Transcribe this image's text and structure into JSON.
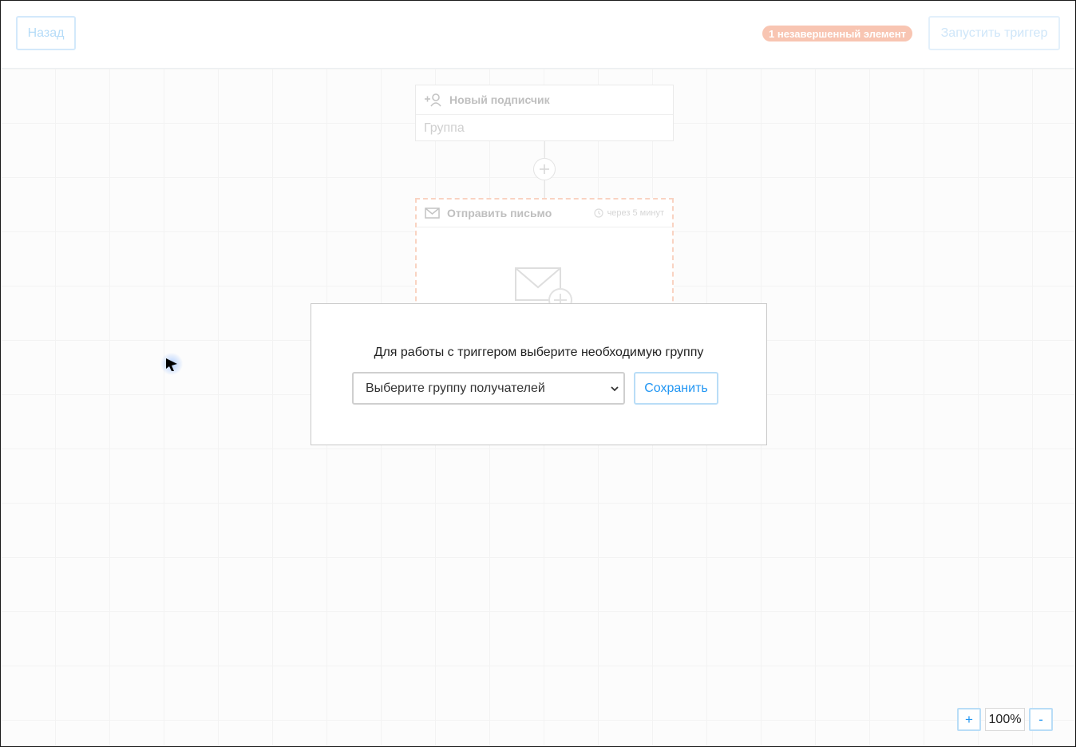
{
  "toolbar": {
    "back_label": "Назад",
    "badge_text": "1 незавершенный элемент",
    "launch_label": "Запустить триггер"
  },
  "trigger_node": {
    "title": "Новый подписчик",
    "body": "Группа",
    "icon": "add-user-icon"
  },
  "email_node": {
    "title": "Отправить письмо",
    "delay": "через 5 минут",
    "icon": "envelope-icon"
  },
  "modal": {
    "title": "Для работы с триггером выберите необходимую группу",
    "select_value": "Выберите группу получателей",
    "save_label": "Сохранить"
  },
  "zoom": {
    "in_label": "+",
    "level": "100%",
    "out_label": "-"
  },
  "colors": {
    "accent": "#2196f3",
    "badge": "#f8c5b2",
    "incomplete_border": "#f9d3c2"
  }
}
